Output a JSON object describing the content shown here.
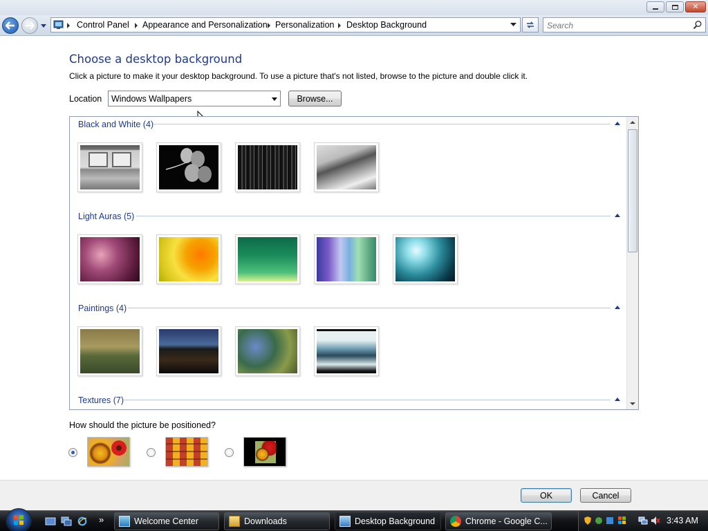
{
  "window": {
    "minimize_icon": "minimize-icon",
    "maximize_icon": "maximize-icon",
    "close_icon": "close-icon"
  },
  "address_bar": {
    "crumbs": [
      "Control Panel",
      "Appearance and Personalization",
      "Personalization",
      "Desktop Background"
    ],
    "search_placeholder": "Search"
  },
  "main": {
    "heading": "Choose a desktop background",
    "instructions": "Click a picture to make it your desktop background. To use a picture that's not listed, browse to the picture and double click it.",
    "location_label": "Location",
    "location_value": "Windows Wallpapers",
    "browse_label": "Browse..."
  },
  "gallery": {
    "groups": [
      {
        "title": "Black and White (4)",
        "count": 4
      },
      {
        "title": "Light Auras (5)",
        "count": 5
      },
      {
        "title": "Paintings (4)",
        "count": 4
      },
      {
        "title": "Textures (7)",
        "count": 7
      }
    ]
  },
  "position": {
    "question": "How should the picture be positioned?",
    "options": [
      "fit-to-screen",
      "tile",
      "center"
    ],
    "selected": 0
  },
  "buttons": {
    "ok": "OK",
    "cancel": "Cancel"
  },
  "taskbar": {
    "tasks": [
      "Welcome Center",
      "Downloads",
      "Desktop Background",
      "Chrome - Google C..."
    ],
    "active_task": "Desktop Background",
    "overflow": "»",
    "clock": "3:43 AM"
  },
  "colors": {
    "heading": "#1e3a8a",
    "taskbar": "#111316",
    "accent": "#2b5fb3"
  }
}
